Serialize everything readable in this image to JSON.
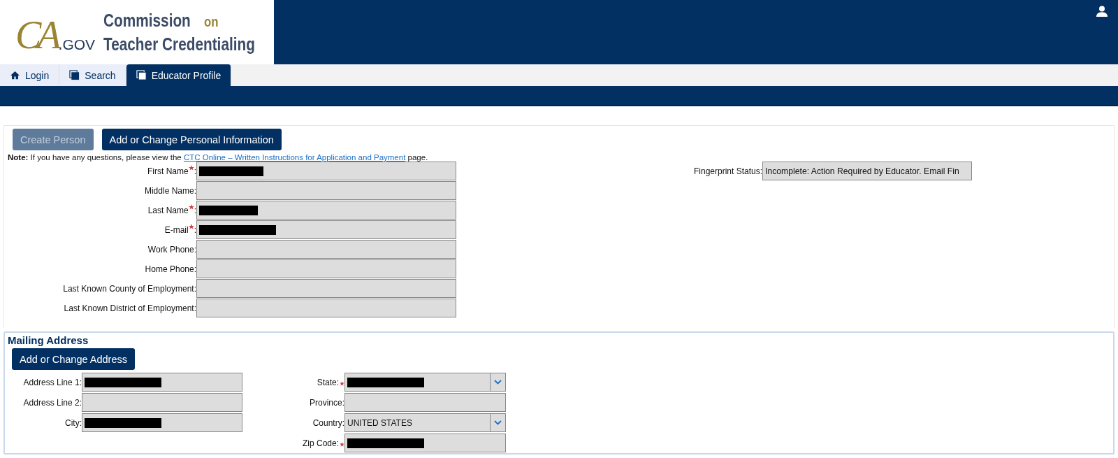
{
  "header": {
    "logo": {
      "mark": "CA",
      "domain": ".GOV",
      "lines": [
        [
          {
            "text": "Commission",
            "accent": false
          },
          {
            "text": "on",
            "accent": true
          }
        ],
        [
          {
            "text": "Teacher Credentialing",
            "accent": false
          }
        ]
      ]
    }
  },
  "tabs": [
    {
      "label": "Login",
      "selected": false
    },
    {
      "label": "Search",
      "selected": false
    },
    {
      "label": "Educator Profile",
      "selected": true
    }
  ],
  "actions": [
    {
      "label": "Create Person",
      "disabled": true
    },
    {
      "label": "Add or Change Personal Information",
      "disabled": false
    }
  ],
  "note": {
    "lead": "Note:",
    "text": "If you have any questions, please view the",
    "link": "CTC Online – Written Instructions for Application and Payment",
    "tail": "page."
  },
  "person_fields": [
    {
      "label": "First Name",
      "required": true,
      "colon": ":",
      "redacted": true
    },
    {
      "label": "Middle Name",
      "required": false,
      "colon": ":",
      "redacted": false
    },
    {
      "label": "Last Name",
      "required": true,
      "colon": ":",
      "redacted": true
    },
    {
      "label": "E-mail",
      "required": true,
      "colon": ":",
      "redacted": true
    },
    {
      "label": "Work Phone",
      "required": false,
      "colon": ":",
      "redacted": false
    },
    {
      "label": "Home Phone",
      "required": false,
      "colon": ":",
      "redacted": false
    },
    {
      "label": "Last Known County of Employment",
      "required": false,
      "colon": ":",
      "redacted": false
    },
    {
      "label": "Last Known District of Employment",
      "required": false,
      "colon": ":",
      "redacted": false
    }
  ],
  "fingerprint": {
    "label": "Fingerprint Status:",
    "value": "Incomplete: Action Required by Educator. Email Fin"
  },
  "mailing_address": {
    "title": "Mailing Address",
    "button": "Add or Change Address",
    "left_fields": [
      {
        "label": "Address Line 1:",
        "required": false,
        "redacted": true
      },
      {
        "label": "Address Line 2:",
        "required": false,
        "redacted": false
      },
      {
        "label": "City:",
        "required": false,
        "redacted": true
      }
    ],
    "right_fields": [
      {
        "label": "State:",
        "kind": "select",
        "required": true,
        "redacted": true
      },
      {
        "label": "Province:",
        "kind": "text",
        "required": false,
        "redacted": false
      },
      {
        "label": "Country:",
        "kind": "select",
        "required": false,
        "redacted": false,
        "value": "UNITED STATES"
      },
      {
        "label": "Zip Code:",
        "kind": "text",
        "required": true,
        "redacted": true
      }
    ]
  }
}
